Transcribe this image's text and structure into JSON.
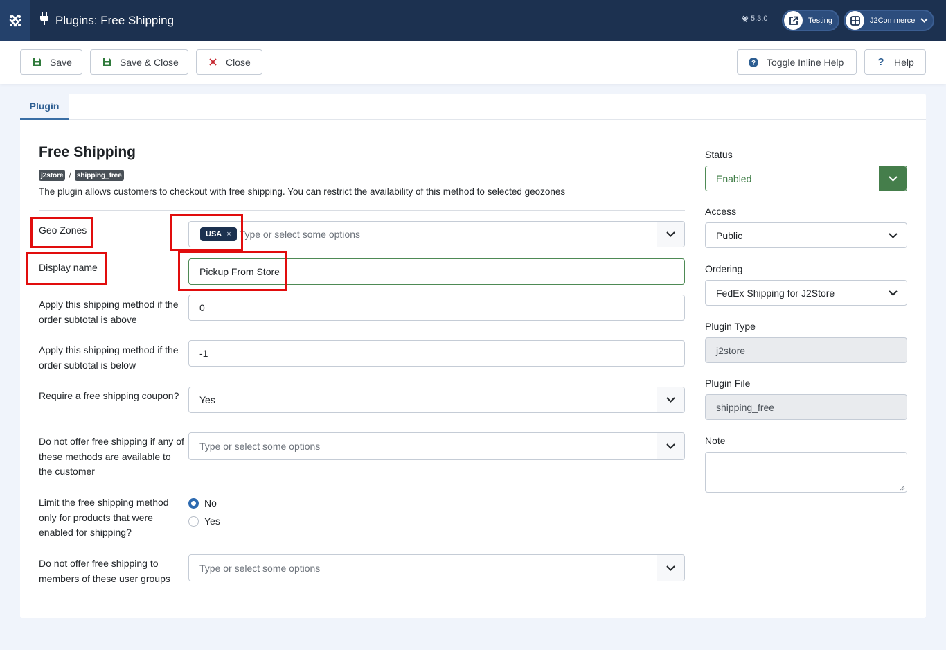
{
  "header": {
    "title": "Plugins: Free Shipping",
    "version": "5.3.0",
    "testing_label": "Testing",
    "site_label": "J2Commerce"
  },
  "toolbar": {
    "save_label": "Save",
    "save_close_label": "Save & Close",
    "close_label": "Close",
    "toggle_help_label": "Toggle Inline Help",
    "help_label": "Help"
  },
  "tabs": [
    {
      "label": "Plugin"
    }
  ],
  "plugin": {
    "heading": "Free Shipping",
    "crumb_group": "j2store",
    "crumb_separator": "/",
    "crumb_element": "shipping_free",
    "description": "The plugin allows customers to checkout with free shipping. You can restrict the availability of this method to selected geozones"
  },
  "form": {
    "geo_zones": {
      "label": "Geo Zones",
      "chip": "USA",
      "chip_remove": "×",
      "placeholder": "Type or select some options"
    },
    "display_name": {
      "label": "Display name",
      "value": "Pickup From Store"
    },
    "subtotal_above": {
      "label": "Apply this shipping method if the order subtotal is above",
      "value": "0"
    },
    "subtotal_below": {
      "label": "Apply this shipping method if the order subtotal is below",
      "value": "-1"
    },
    "require_coupon": {
      "label": "Require a free shipping coupon?",
      "value": "Yes"
    },
    "exclude_methods": {
      "label": "Do not offer free shipping if any of these methods are available to the customer",
      "placeholder": "Type or select some options"
    },
    "limit_products": {
      "label": "Limit the free shipping method only for products that were enabled for shipping?",
      "options": [
        "No",
        "Yes"
      ],
      "selected": "No"
    },
    "exclude_groups": {
      "label": "Do not offer free shipping to members of these user groups",
      "placeholder": "Type or select some options"
    }
  },
  "sidebar": {
    "status": {
      "label": "Status",
      "value": "Enabled"
    },
    "access": {
      "label": "Access",
      "value": "Public"
    },
    "ordering": {
      "label": "Ordering",
      "value": "FedEx Shipping for J2Store"
    },
    "plugin_type": {
      "label": "Plugin Type",
      "value": "j2store"
    },
    "plugin_file": {
      "label": "Plugin File",
      "value": "shipping_free"
    },
    "note": {
      "label": "Note",
      "value": ""
    }
  },
  "colors": {
    "header_bg": "#1c3150",
    "accent": "#2d5e92",
    "success": "#457e4b",
    "highlight": "#e10d0d"
  }
}
